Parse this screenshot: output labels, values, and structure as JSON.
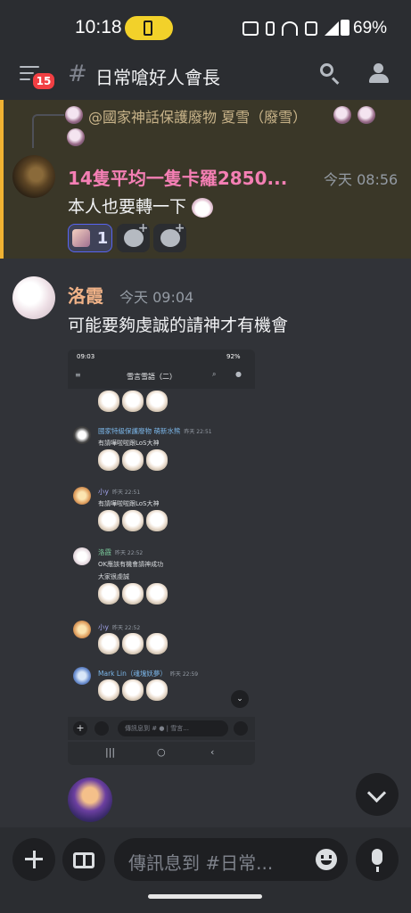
{
  "status_bar": {
    "time": "10:18",
    "battery": "69%"
  },
  "header": {
    "unread_count": "15",
    "hash": "#",
    "channel_name": "日常嗆好人會長"
  },
  "messages": [
    {
      "reply_to": "@國家神話保護廢物 夏雪（廢雪）",
      "username": "14隻平均一隻卡羅2850...",
      "timestamp": "今天 08:56",
      "text": "本人也要轉一下",
      "reactions": [
        {
          "count": "1"
        }
      ]
    },
    {
      "username": "洛霞",
      "timestamp": "今天 09:04",
      "text": "可能要夠虔誠的請神才有機會"
    }
  ],
  "embedded_screenshot": {
    "status_time": "09:03",
    "status_battery": "92%",
    "channel_name": "雪言雪語（二）",
    "messages": [
      {
        "username": "國家特級保護廢物 萌新水熊",
        "timestamp": "昨天 22:51",
        "text": "有請嘩啦啦跟LoS大神",
        "name_color": "#7bb6e8"
      },
      {
        "username": "小y",
        "timestamp": "昨天 22:51",
        "text": "有請嘩啦啦跟LoS大神",
        "name_color": "#a5a6f0"
      },
      {
        "username": "洛霞",
        "timestamp": "昨天 22:52",
        "text": "OK應該有機會請神成功",
        "text2": "大家很虔誠",
        "name_color": "#7ed0a0"
      },
      {
        "username": "小y",
        "timestamp": "昨天 22:52",
        "text": "",
        "name_color": "#a5a6f0"
      },
      {
        "username": "Mark Lin（魂塊妖夢）",
        "timestamp": "昨天 22:59",
        "text": "",
        "name_color": "#7bb6e8"
      }
    ],
    "input_placeholder": "傳訊息到 #",
    "input_placeholder_channel": "雪言..."
  },
  "composer": {
    "placeholder": "傳訊息到 #日常..."
  },
  "icons": [
    "hamburger-icon",
    "search-icon",
    "members-icon",
    "plus-icon",
    "gift-icon",
    "emoji-icon",
    "mic-icon",
    "chevron-down-icon"
  ],
  "colors": {
    "background": "#313338",
    "header": "#2b2d31",
    "mention_highlight": "#3a3728",
    "mention_bar": "#f0b232",
    "badge": "#f23f43",
    "username_pink": "#f47fb4",
    "username_orange": "#f0b287"
  }
}
